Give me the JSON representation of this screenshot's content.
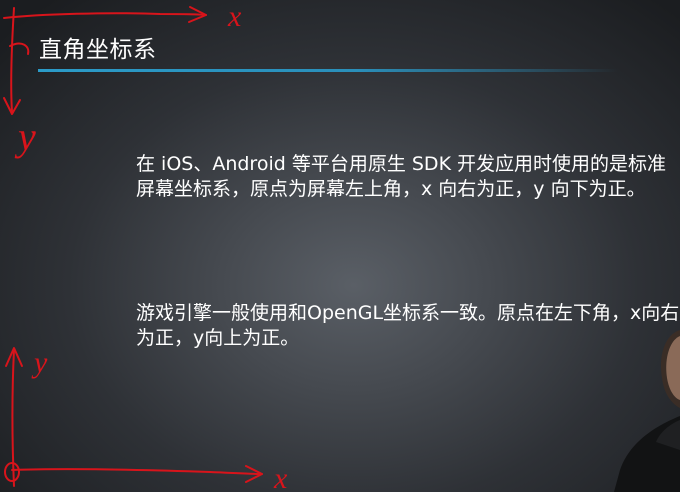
{
  "slide": {
    "title": "直角坐标系",
    "paragraphs": [
      "在 iOS、Android 等平台用原生 SDK 开发应用时使用的是标准屏幕坐标系，原点为屏幕左上角，x 向右为正，y 向下为正。",
      "游戏引擎一般使用和OpenGL坐标系一致。原点在左下角，x向右为正，y向上为正。"
    ]
  },
  "annotations": {
    "top_x_label": "x",
    "top_y_label": "y",
    "bottom_x_label": "x",
    "bottom_y_label": "y",
    "ink_color": "#d8141b"
  },
  "colors": {
    "accent_rule": "#2b9bc8",
    "background_center": "#5a5f66",
    "background_edge": "#1b1d20"
  }
}
